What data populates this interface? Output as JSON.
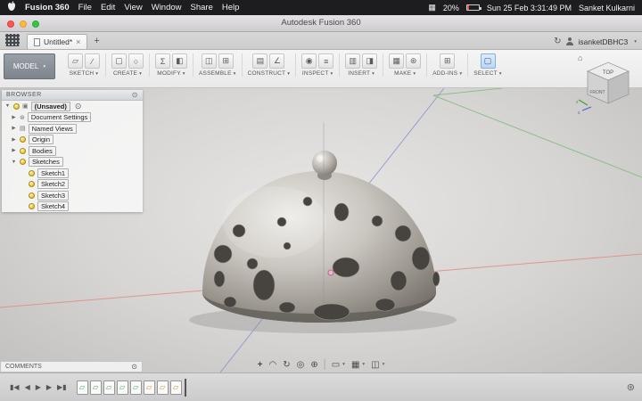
{
  "menubar": {
    "app_name": "Fusion 360",
    "menus": [
      "File",
      "Edit",
      "View",
      "Window",
      "Share",
      "Help"
    ],
    "icons": {
      "grid": "▦"
    },
    "battery": "20%",
    "datetime": "Sun 25 Feb 3:31:49 PM",
    "user": "Sanket Kulkarni"
  },
  "titlebar": {
    "title": "Autodesk Fusion 360"
  },
  "tabbar": {
    "tab": "Untitled*",
    "close": "×",
    "add": "+",
    "sync": "↻",
    "account": "isanketDBHC3",
    "caret": "▾"
  },
  "toolbar": {
    "workspace": "MODEL",
    "caret": "▾",
    "groups": [
      {
        "name": "sketch",
        "label": "SKETCH",
        "glyphs": [
          "▱",
          "∕"
        ]
      },
      {
        "name": "create",
        "label": "CREATE",
        "glyphs": [
          "▢",
          "○"
        ]
      },
      {
        "name": "modify",
        "label": "MODIFY",
        "glyphs": [
          "Σ",
          "◧"
        ]
      },
      {
        "name": "assemble",
        "label": "ASSEMBLE",
        "glyphs": [
          "◫",
          "⊞"
        ]
      },
      {
        "name": "construct",
        "label": "CONSTRUCT",
        "glyphs": [
          "▤",
          "∠"
        ]
      },
      {
        "name": "inspect",
        "label": "INSPECT",
        "glyphs": [
          "◉",
          "≡"
        ]
      },
      {
        "name": "insert",
        "label": "INSERT",
        "glyphs": [
          "▥",
          "◨"
        ]
      },
      {
        "name": "make",
        "label": "MAKE",
        "glyphs": [
          "▦",
          "⊛"
        ]
      },
      {
        "name": "addins",
        "label": "ADD-INS",
        "glyphs": [
          "⊞"
        ]
      },
      {
        "name": "select",
        "label": "SELECT",
        "glyphs": [
          "▢"
        ]
      }
    ]
  },
  "viewcube": {
    "home": "⌂",
    "top": "TOP",
    "front": "FRONT"
  },
  "browser": {
    "title": "BROWSER",
    "root": "(Unsaved)",
    "root_doc_glyph": "▣",
    "eye_glyph": "⊙",
    "collapse_glyph": "⊙",
    "items": [
      {
        "label": "Document Settings",
        "glyph": "⊛"
      },
      {
        "label": "Named Views",
        "glyph": "▤"
      },
      {
        "label": "Origin"
      },
      {
        "label": "Bodies"
      },
      {
        "label": "Sketches"
      }
    ],
    "sketches": [
      {
        "label": "Sketch1"
      },
      {
        "label": "Sketch2"
      },
      {
        "label": "Sketch3"
      },
      {
        "label": "Sketch4"
      }
    ]
  },
  "comments": {
    "title": "COMMENTS",
    "collapse_glyph": "⊙"
  },
  "navbar": {
    "caret": "▾",
    "icons": [
      {
        "name": "pan",
        "glyph": "+"
      },
      {
        "name": "hand",
        "glyph": "◠"
      },
      {
        "name": "orbit",
        "glyph": "↻"
      },
      {
        "name": "look-at",
        "glyph": "◎"
      },
      {
        "name": "zoom",
        "glyph": "⊕"
      }
    ],
    "dropdowns": [
      {
        "name": "display-settings",
        "glyph": "▭"
      },
      {
        "name": "grid-and-snaps",
        "glyph": "▦"
      },
      {
        "name": "viewports",
        "glyph": "◫"
      }
    ]
  },
  "timeline": {
    "controls": [
      {
        "name": "go-to-start",
        "glyph": "▮◀"
      },
      {
        "name": "step-back",
        "glyph": "◀"
      },
      {
        "name": "play",
        "glyph": "▶"
      },
      {
        "name": "step-forward",
        "glyph": "▶"
      },
      {
        "name": "go-to-end",
        "glyph": "▶▮"
      }
    ],
    "features": [
      {
        "name": "sketch-feature",
        "glyph": "▱"
      },
      {
        "name": "sketch-feature",
        "glyph": "▱"
      },
      {
        "name": "sketch-feature",
        "glyph": "▱"
      },
      {
        "name": "sketch-feature",
        "glyph": "▱"
      },
      {
        "name": "sketch-feature",
        "glyph": "▱"
      },
      {
        "name": "feature",
        "glyph": "▱"
      },
      {
        "name": "feature",
        "glyph": "▱"
      },
      {
        "name": "feature",
        "glyph": "▱"
      }
    ],
    "gear": "⊛"
  }
}
